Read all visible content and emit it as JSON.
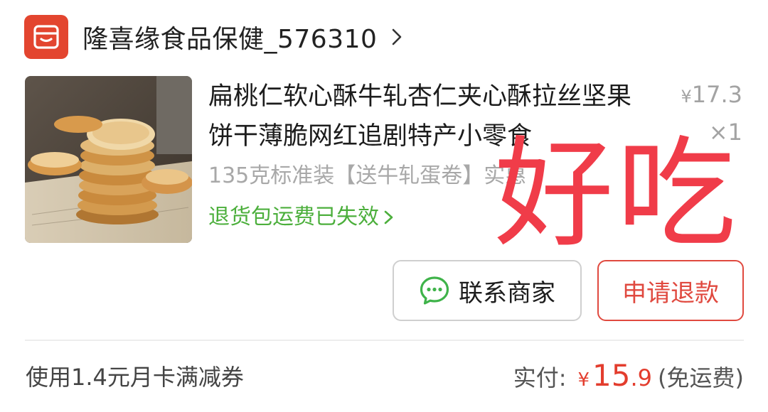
{
  "store": {
    "name": "隆喜缘食品保健_576310",
    "logo_icon": "store-icon",
    "brand_color": "#e3452f"
  },
  "product": {
    "title": "扁桃仁软心酥牛轧杏仁夹心酥拉丝坚果饼干薄脆网红追剧特产小零食",
    "spec": "135克标准装【送牛轧蛋卷】实惠",
    "return_note": "退货包运费已失效",
    "unit_price_symbol": "¥",
    "unit_price": "17.3",
    "quantity": "×1"
  },
  "overlay": {
    "text": "好吃",
    "color": "#f03c49"
  },
  "actions": {
    "contact_label": "联系商家",
    "refund_label": "申请退款"
  },
  "footer": {
    "coupon_text": "使用1.4元月卡满减券",
    "paid_label": "实付:",
    "paid_symbol": "¥",
    "paid_integer": "15",
    "paid_decimal": ".9",
    "shipping_note": "(免运费)"
  }
}
